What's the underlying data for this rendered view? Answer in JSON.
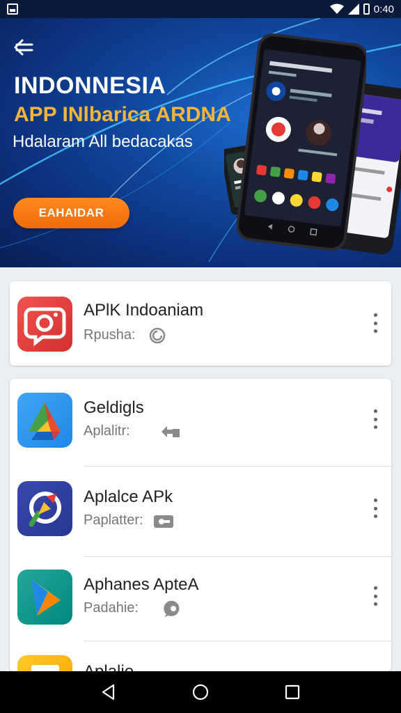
{
  "status_bar": {
    "time": "0:40",
    "icons": [
      "sd-card-icon",
      "wifi-icon",
      "signal-icon",
      "battery-icon"
    ]
  },
  "banner": {
    "title": "INDONNESIA",
    "subtitle": "APP INlbarica ARDNA",
    "tagline": "Hdalaram All bedacakas",
    "button_label": "EAHAIDAR",
    "colors": {
      "accent": "#f4b53a",
      "button": "#f06a0a",
      "background": "#0c2f78"
    }
  },
  "featured": {
    "name": "APlK Indoaniam",
    "meta_label": "Rpusha:",
    "icon": "camera-icon",
    "color": "#e53935"
  },
  "apps": [
    {
      "name": "Geldigls",
      "meta_label": "Aplalitr:",
      "icon": "drive-icon",
      "meta_icon": "share-icon"
    },
    {
      "name": "Aplalce APk",
      "meta_label": "Paplatter:",
      "icon": "compass-icon",
      "meta_icon": "ticket-icon"
    },
    {
      "name": "Aphanes ApteA",
      "meta_label": "Padahie:",
      "icon": "play-icon",
      "meta_icon": "bubble-icon"
    },
    {
      "name": "Aplalie",
      "meta_label": "",
      "icon": "folder-icon",
      "meta_icon": ""
    }
  ],
  "nav_bar": {
    "buttons": [
      "back-nav-icon",
      "home-nav-icon",
      "recents-nav-icon"
    ]
  }
}
